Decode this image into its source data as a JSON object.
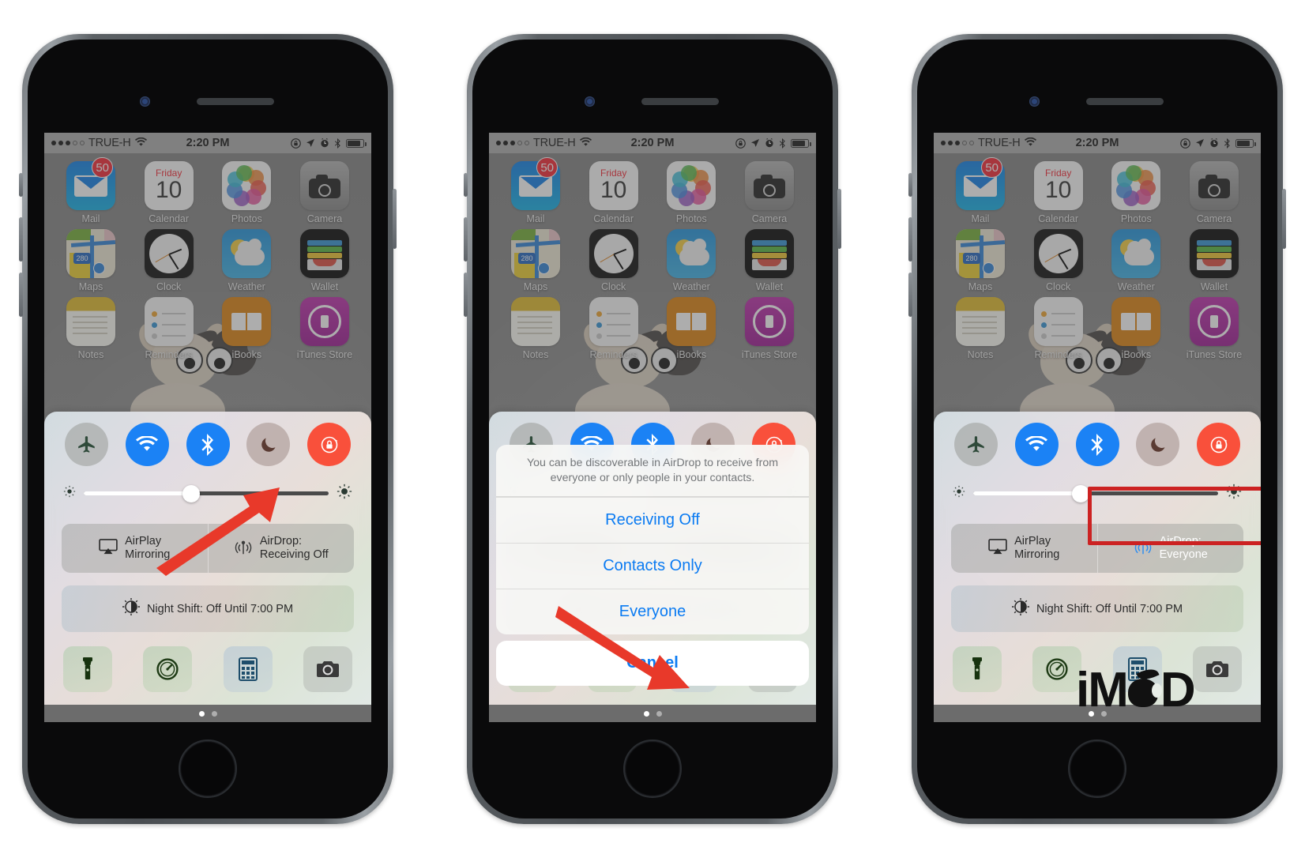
{
  "statusbar": {
    "carrier": "TRUE-H",
    "signal_dots_filled": 3,
    "signal_dots_empty": 2,
    "wifi_icon": "wifi-icon",
    "time": "2:20 PM",
    "icons": [
      "rotation-lock-icon",
      "location-arrow-icon",
      "alarm-clock-icon",
      "bluetooth-icon",
      "battery-icon"
    ]
  },
  "homescreen": {
    "row1": [
      {
        "label": "Mail",
        "icon": "mail-icon",
        "badge": "50"
      },
      {
        "label": "Calendar",
        "icon": "calendar-icon",
        "day": "Friday",
        "date": "10"
      },
      {
        "label": "Photos",
        "icon": "photos-icon"
      },
      {
        "label": "Camera",
        "icon": "camera-icon"
      }
    ],
    "row2": [
      {
        "label": "Maps",
        "icon": "maps-icon",
        "route": "280"
      },
      {
        "label": "Clock",
        "icon": "clock-icon"
      },
      {
        "label": "Weather",
        "icon": "weather-icon"
      },
      {
        "label": "Wallet",
        "icon": "wallet-icon"
      }
    ],
    "row3": [
      {
        "label": "Notes",
        "icon": "notes-icon"
      },
      {
        "label": "Reminders",
        "icon": "reminders-icon"
      },
      {
        "label": "iBooks",
        "icon": "ibooks-icon"
      },
      {
        "label": "iTunes Store",
        "icon": "itunes-store-icon"
      }
    ]
  },
  "control_center": {
    "toggles": [
      {
        "name": "airplane-mode-toggle",
        "icon": "airplane-icon",
        "state": "off"
      },
      {
        "name": "wifi-toggle",
        "icon": "wifi-icon",
        "state": "on"
      },
      {
        "name": "bluetooth-toggle",
        "icon": "bluetooth-icon",
        "state": "on"
      },
      {
        "name": "do-not-disturb-toggle",
        "icon": "moon-icon",
        "state": "off"
      },
      {
        "name": "rotation-lock-toggle",
        "icon": "rotation-lock-icon",
        "state": "on"
      }
    ],
    "brightness": {
      "label": "Brightness",
      "value_percent": 44
    },
    "airplay_label_line1": "AirPlay",
    "airplay_label_line2": "Mirroring",
    "airdrop_label_line1": "AirDrop:",
    "airdrop_state_off": "Receiving Off",
    "airdrop_state_everyone": "Everyone",
    "night_shift": "Night Shift: Off Until 7:00 PM",
    "shortcuts": [
      {
        "name": "flashlight-shortcut",
        "icon": "flashlight-icon"
      },
      {
        "name": "timer-shortcut",
        "icon": "timer-icon"
      },
      {
        "name": "calculator-shortcut",
        "icon": "calculator-icon"
      },
      {
        "name": "camera-shortcut",
        "icon": "camera-icon"
      }
    ],
    "page_dots": {
      "total": 2,
      "active": 1
    }
  },
  "action_sheet": {
    "title": "You can be discoverable in AirDrop to receive from everyone or only people in your contacts.",
    "options": [
      "Receiving Off",
      "Contacts Only",
      "Everyone"
    ],
    "cancel": "Cancel"
  },
  "annotations": {
    "arrow_color": "#e8392a",
    "highlight_box_color": "#cc2222",
    "arrow1_target": "airdrop-button-phone-1",
    "arrow2_target": "sheet-option-everyone",
    "box_target": "airdrop-button-phone-3"
  },
  "watermark": {
    "part1": "iM",
    "part2": "D",
    "apple": "apple-logo-icon"
  }
}
